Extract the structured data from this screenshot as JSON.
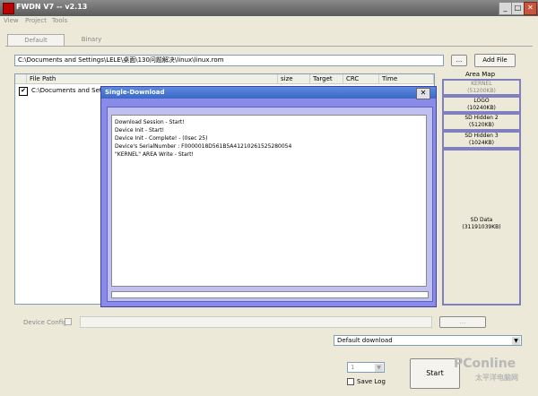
{
  "window": {
    "title": "FWDN V7 -- v2.13",
    "minimize": "_",
    "maximize": "□",
    "close": "✕"
  },
  "menu": {
    "items": [
      "View",
      "Project",
      "Tools"
    ]
  },
  "tabs": [
    {
      "label": "Default"
    },
    {
      "label": "Binary"
    }
  ],
  "path": {
    "value": "C:\\Documents and Settings\\LELE\\桌面\\130问题解决\\linux\\linux.rom",
    "browse_label": "...",
    "add_file_label": "Add File"
  },
  "filelist": {
    "columns": [
      "File Path",
      "size",
      "Target",
      "CRC",
      "Time"
    ],
    "rows": [
      {
        "checked": "✔",
        "path": "C:\\Documents and Setting"
      }
    ]
  },
  "area_map": {
    "title": "Area Map",
    "areas": [
      {
        "name": "KERNEL",
        "size": "(51200KB)"
      },
      {
        "name": "LOGO",
        "size": "(10240KB)"
      },
      {
        "name": "SD Hidden 2",
        "size": "(5120KB)"
      },
      {
        "name": "SD Hidden 3",
        "size": "(1024KB)"
      },
      {
        "name": "SD Data",
        "size": "(31191039KB)"
      }
    ]
  },
  "dialog": {
    "title": "Single-Download",
    "close": "✕",
    "log": [
      "Download Session - Start!",
      "Device Init - Start!",
      "Device Init - Complete! - (0sec 25)",
      "Device's SerialNumber : F0000018D561B5A41210261525280054",
      "\"KERNEL\" AREA Write - Start!"
    ]
  },
  "device_config": {
    "label": "Device Config",
    "browse_label": "..."
  },
  "download_mode": {
    "value": "Default download",
    "arrow": "▼"
  },
  "device_count": {
    "value": "1",
    "arrow": "▼"
  },
  "save_log": {
    "label": "Save Log"
  },
  "start": {
    "label": "Start"
  },
  "watermark": {
    "brand": "PConline",
    "sub": "太平洋电脑网"
  }
}
